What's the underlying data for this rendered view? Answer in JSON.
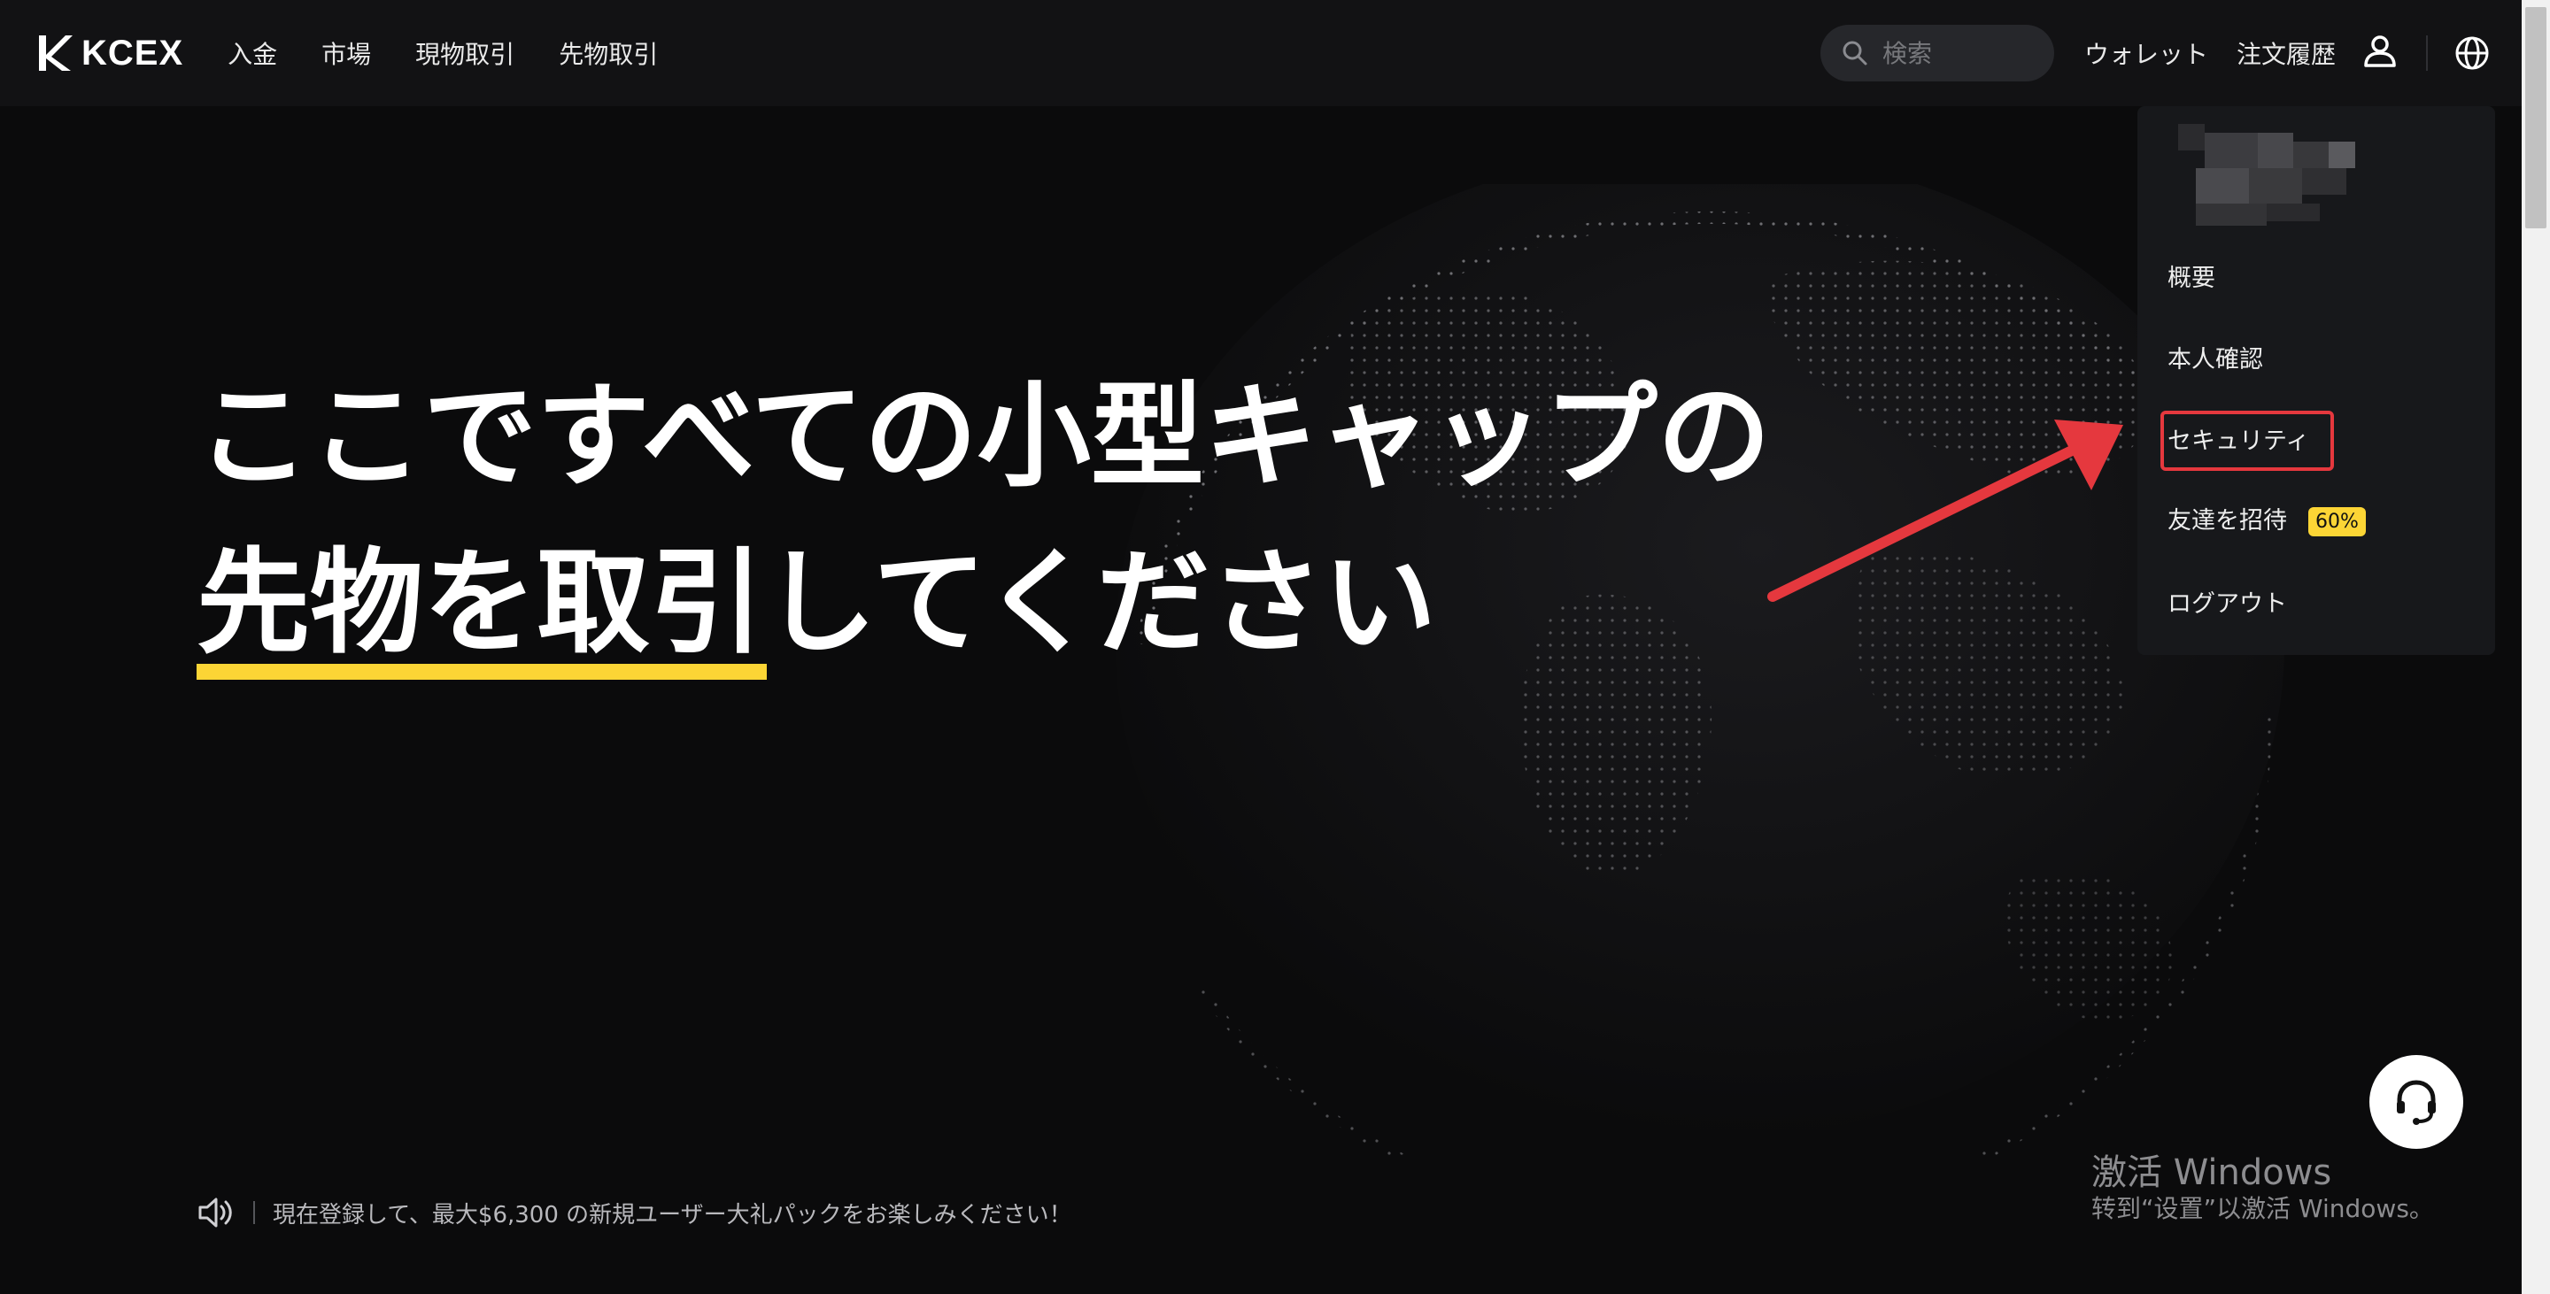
{
  "header": {
    "brand": "KCEX",
    "nav": [
      "入金",
      "市場",
      "現物取引",
      "先物取引"
    ],
    "search_placeholder": "検索",
    "wallet": "ウォレット",
    "orders": "注文履歴"
  },
  "hero": {
    "line1": "ここですべての小型キャップの",
    "line2": "先物を取引してください",
    "announcement": "現在登録して、最大$6,300 の新規ユーザー大礼パックをお楽しみください！"
  },
  "user_menu": {
    "items": [
      "概要",
      "本人確認",
      "セキュリティ",
      "友達を招待",
      "ログアウト"
    ],
    "invite_badge": "60%"
  },
  "watermark": {
    "title": "激活 Windows",
    "subtitle": "转到“设置”以激活 Windows。"
  },
  "colors": {
    "accent": "#fcd535",
    "highlight": "#e5383e",
    "background": "#0b0b0c"
  },
  "icons": [
    "kcex-logo-icon",
    "search-icon",
    "user-icon",
    "globe-icon",
    "speaker-icon",
    "headset-icon"
  ]
}
